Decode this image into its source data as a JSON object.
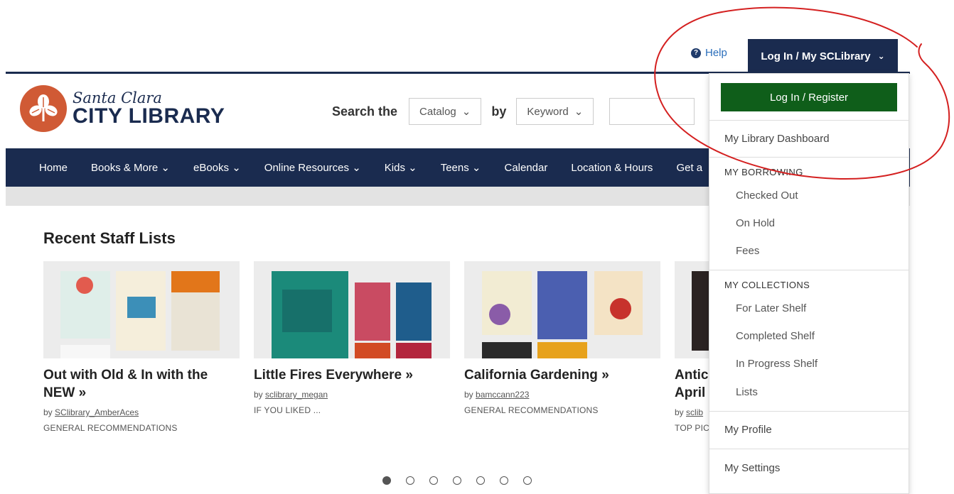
{
  "utility": {
    "help_label": "Help",
    "login_tab_label": "Log In / My SCLibrary"
  },
  "logo": {
    "line1": "Santa Clara",
    "line2": "CITY LIBRARY"
  },
  "search": {
    "label": "Search the",
    "scope_value": "Catalog",
    "by_label": "by",
    "field_value": "Keyword"
  },
  "nav": {
    "items": [
      "Home",
      "Books & More",
      "eBooks",
      "Online Resources",
      "Kids",
      "Teens",
      "Calendar",
      "Location & Hours",
      "Get a"
    ]
  },
  "staff_lists": {
    "title": "Recent Staff Lists",
    "cards": [
      {
        "title": "Out with Old & In with the NEW",
        "by": "by",
        "user": "SClibrary_AmberAces",
        "category": "GENERAL RECOMMENDATIONS"
      },
      {
        "title": "Little Fires Everywhere",
        "by": "by",
        "user": "sclibrary_megan",
        "category": "IF YOU LIKED ..."
      },
      {
        "title": "California Gardening",
        "by": "by",
        "user": "bamccann223",
        "category": "GENERAL RECOMMENDATIONS"
      },
      {
        "title": "Antic April",
        "by": "by",
        "user": "sclib",
        "category": "TOP PIC"
      }
    ],
    "pages": 7,
    "active_page": 1
  },
  "dropdown": {
    "login_button": "Log In / Register",
    "dashboard": "My Library Dashboard",
    "borrowing_heading": "MY BORROWING",
    "borrowing_items": [
      "Checked Out",
      "On Hold",
      "Fees"
    ],
    "collections_heading": "MY COLLECTIONS",
    "collection_items": [
      "For Later Shelf",
      "Completed Shelf",
      "In Progress Shelf",
      "Lists"
    ],
    "profile": "My Profile",
    "settings": "My Settings"
  },
  "colors": {
    "navy": "#1a2b4f",
    "brand_orange": "#d05a35",
    "login_green": "#0f5e1a",
    "annotation_red": "#d42020"
  }
}
